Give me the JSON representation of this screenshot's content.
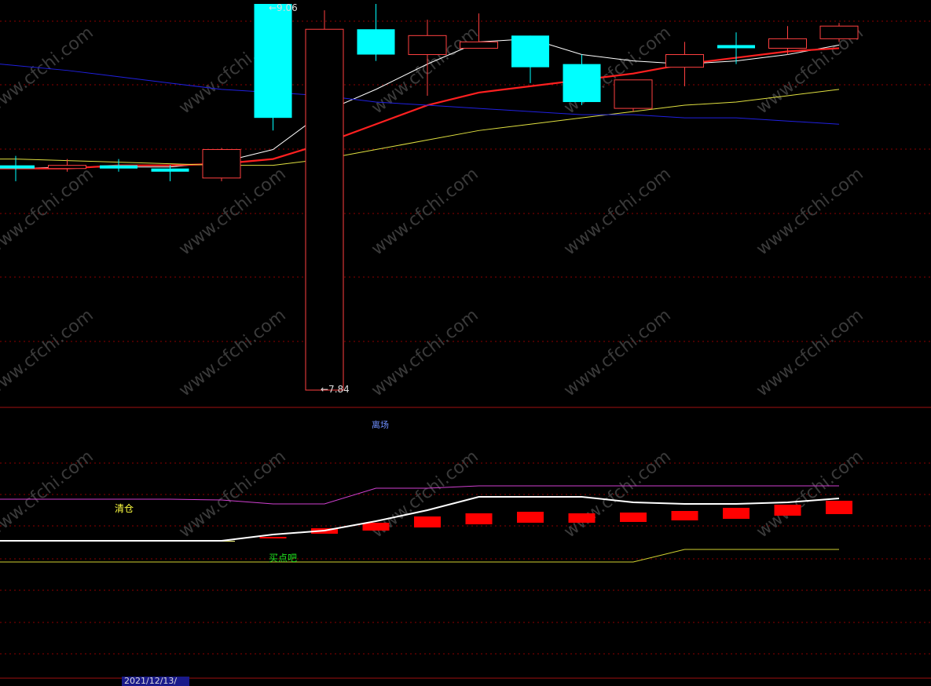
{
  "chart_data": [
    {
      "type": "candlestick",
      "panel": "price",
      "candles": [
        {
          "open": 8.55,
          "close": 8.54,
          "high": 8.58,
          "low": 8.5
        },
        {
          "open": 8.54,
          "close": 8.55,
          "high": 8.57,
          "low": 8.53
        },
        {
          "open": 8.55,
          "close": 8.54,
          "high": 8.57,
          "low": 8.53
        },
        {
          "open": 8.54,
          "close": 8.53,
          "high": 8.55,
          "low": 8.5
        },
        {
          "open": 8.51,
          "close": 8.6,
          "high": 8.605,
          "low": 8.5
        },
        {
          "open": 9.06,
          "close": 8.7,
          "high": 9.06,
          "low": 8.66
        },
        {
          "open": 7.84,
          "close": 8.98,
          "high": 9.04,
          "low": 7.84
        },
        {
          "open": 8.98,
          "close": 8.9,
          "high": 9.06,
          "low": 8.88
        },
        {
          "open": 8.9,
          "close": 8.96,
          "high": 9.01,
          "low": 8.77
        },
        {
          "open": 8.92,
          "close": 8.94,
          "high": 9.03,
          "low": 8.92
        },
        {
          "open": 8.96,
          "close": 8.86,
          "high": 8.96,
          "low": 8.81
        },
        {
          "open": 8.87,
          "close": 8.75,
          "high": 8.9,
          "low": 8.74
        },
        {
          "open": 8.73,
          "close": 8.82,
          "high": 8.82,
          "low": 8.72
        },
        {
          "open": 8.86,
          "close": 8.9,
          "high": 8.94,
          "low": 8.8
        },
        {
          "open": 8.93,
          "close": 8.92,
          "high": 8.97,
          "low": 8.87
        },
        {
          "open": 8.92,
          "close": 8.95,
          "high": 8.99,
          "low": 8.9
        },
        {
          "open": 8.95,
          "close": 8.99,
          "high": 9.0,
          "low": 8.94
        }
      ],
      "moving_averages": [
        {
          "color": "#ffffff",
          "values": [
            8.54,
            8.545,
            8.545,
            8.545,
            8.56,
            8.6,
            8.72,
            8.79,
            8.87,
            8.94,
            8.95,
            8.9,
            8.88,
            8.87,
            8.88,
            8.9,
            8.93
          ]
        },
        {
          "color": "#ff2020",
          "values": [
            8.54,
            8.54,
            8.55,
            8.55,
            8.555,
            8.57,
            8.62,
            8.68,
            8.74,
            8.78,
            8.8,
            8.82,
            8.84,
            8.87,
            8.89,
            8.91,
            8.92
          ]
        },
        {
          "color": "#e0e040",
          "values": [
            8.57,
            8.565,
            8.56,
            8.555,
            8.55,
            8.55,
            8.57,
            8.6,
            8.63,
            8.66,
            8.68,
            8.7,
            8.72,
            8.74,
            8.75,
            8.77,
            8.79
          ]
        },
        {
          "color": "#2020e0",
          "values": [
            8.87,
            8.85,
            8.83,
            8.81,
            8.79,
            8.78,
            8.77,
            8.75,
            8.74,
            8.73,
            8.72,
            8.71,
            8.71,
            8.7,
            8.7,
            8.69,
            8.68
          ]
        }
      ],
      "annotations": [
        {
          "text": "9.06",
          "arrow": "←"
        },
        {
          "text": "7.84",
          "arrow": "←"
        }
      ],
      "watermark": "www.cfchi.com"
    },
    {
      "type": "indicator",
      "panel": "lower",
      "title": "离场",
      "magenta_line": [
        636,
        636,
        636,
        636,
        637,
        642,
        642,
        622,
        622,
        619,
        619,
        619,
        619,
        619,
        619,
        619,
        619
      ],
      "white_line": [
        689,
        689,
        689,
        689,
        689,
        681,
        676,
        664,
        650,
        633,
        633,
        633,
        640,
        642,
        642,
        640,
        635
      ],
      "yellow_line": [
        716,
        716,
        716,
        716,
        716,
        716,
        716,
        716,
        716,
        716,
        716,
        716,
        716,
        700,
        700,
        700,
        700
      ],
      "bars": [
        {
          "color": "#ffff80",
          "value": 689,
          "base": 690
        },
        {
          "color": "#ffff80",
          "value": 688,
          "base": 689
        },
        {
          "color": "#ffff80",
          "value": 689,
          "base": 690
        },
        {
          "color": "#ffff80",
          "value": 689,
          "base": 690
        },
        {
          "color": "#ffff80",
          "value": 689,
          "base": 690
        },
        {
          "color": "#ff0000",
          "value": 684,
          "base": 686
        },
        {
          "color": "#ff0000",
          "value": 673,
          "base": 680
        },
        {
          "color": "#ff0000",
          "value": 666,
          "base": 676
        },
        {
          "color": "#ff0000",
          "value": 658,
          "base": 672
        },
        {
          "color": "#ff0000",
          "value": 654,
          "base": 668
        },
        {
          "color": "#ff0000",
          "value": 652,
          "base": 666
        },
        {
          "color": "#ff0000",
          "value": 654,
          "base": 666
        },
        {
          "color": "#ff0000",
          "value": 653,
          "base": 665
        },
        {
          "color": "#ff0000",
          "value": 651,
          "base": 663
        },
        {
          "color": "#ff0000",
          "value": 647,
          "base": 661
        },
        {
          "color": "#ff0000",
          "value": 643,
          "base": 657
        },
        {
          "color": "#ff0000",
          "value": 638,
          "base": 655
        }
      ],
      "labels": {
        "clear": "清仓",
        "buy": "买点吧"
      }
    }
  ],
  "labels": {
    "high": "←9.06",
    "low": "←7.84",
    "indicator_title": "离场",
    "clear": "清仓",
    "buy": "买点吧",
    "date": "2021/12/13/"
  },
  "colors": {
    "background": "#000000",
    "up_candle": "#ff4040",
    "down_candle": "#00ffff",
    "grid": "#8b0000",
    "watermark": "#3a3a3a"
  }
}
